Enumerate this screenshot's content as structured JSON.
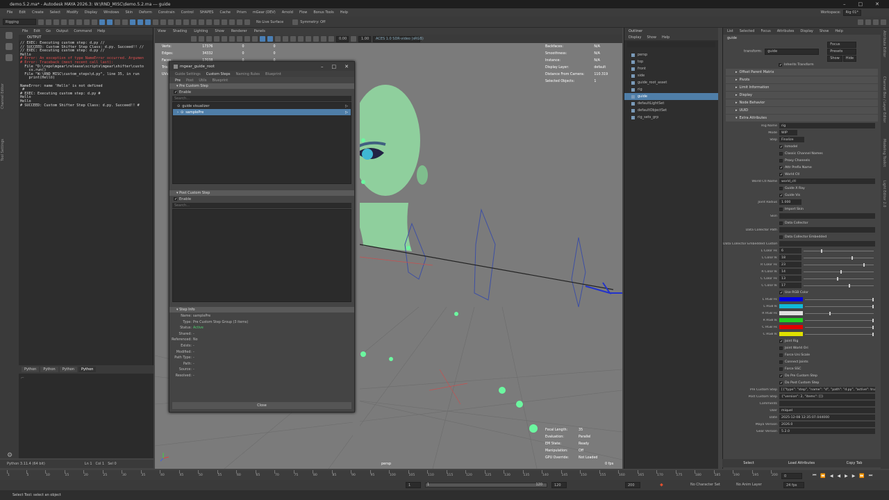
{
  "window": {
    "title": "demo.5.2.ma* - Autodesk MAYA 2026.3: W:\\RND_MISC\\demo.5.2.ma --- guide"
  },
  "menubar": [
    "File",
    "Edit",
    "Create",
    "Select",
    "Modify",
    "Display",
    "Windows",
    "Skin",
    "Deform",
    "Constrain",
    "Control",
    "SHAPES",
    "Cache",
    "Prism",
    "mGear (DEV)",
    "Arnold",
    "Flow",
    "Bonus Tools",
    "Help"
  ],
  "workspace": {
    "label": "Workspace:",
    "value": "Rig 01*"
  },
  "shelf": {
    "menuset": "Rigging",
    "symmetry": "Symmetry: Off",
    "live": "No Live Surface"
  },
  "left_tools_labels": [
    "Channel Editor",
    "Tool Settings"
  ],
  "script_editor": {
    "menus": [
      "File",
      "Edit",
      "Go",
      "Output",
      "Command",
      "Help"
    ],
    "output_label": "OUTPUT",
    "log": [
      {
        "t": "// EXEC: Executing custom step: d.py //",
        "e": false
      },
      {
        "t": "// SUCCEED: Custom Shifter Step Class: d.py. Succeed!! //",
        "e": false
      },
      {
        "t": "// EXEC: Executing custom step: d.py //",
        "e": false
      },
      {
        "t": "Hello",
        "e": false
      },
      {
        "t": "# Error: An exception of type NameError occurred. Argumen",
        "e": true
      },
      {
        "t": "# Error: Traceback (most recent call last):",
        "e": true
      },
      {
        "t": "  File \"D:\\repo\\mgear\\release\\scripts\\mgear\\shifter\\custo",
        "e": false
      },
      {
        "t": "    cs.run()",
        "e": false
      },
      {
        "t": "  File \"W:\\RND_MISC\\custom_steps\\d.py\", line 35, in run",
        "e": false
      },
      {
        "t": "    print(Hello)",
        "e": false
      },
      {
        "t": "",
        "e": false
      },
      {
        "t": "NameError: name 'Hello' is not defined",
        "e": false
      },
      {
        "t": " #",
        "e": false
      },
      {
        "t": "# EXEC: Executing custom step: d.py #",
        "e": false
      },
      {
        "t": "Hello",
        "e": false
      },
      {
        "t": "Hello",
        "e": false
      },
      {
        "t": "# SUCCEED: Custom Shifter Step Class: d.py. Succeed!! #",
        "e": false
      }
    ],
    "tabs": [
      "Python",
      "Python",
      "Python",
      "Python"
    ],
    "pyline": "Python 3.11.4 (64 bit)",
    "pyline_stats": [
      "Ln 1",
      "Col 1",
      "Sel 0"
    ]
  },
  "viewport": {
    "menus": [
      "View",
      "Shading",
      "Lighting",
      "Show",
      "Renderer",
      "Panels"
    ],
    "exposure": "0.00",
    "gamma": "1.00",
    "colorspace": "ACES 1.0 SDR-video (sRGB)",
    "hud_left": [
      [
        "Verts:",
        "17376",
        "0",
        "0"
      ],
      [
        "Edges:",
        "34332",
        "0",
        "0"
      ],
      [
        "Faces:",
        "17038",
        "0",
        "0"
      ],
      [
        "Tris:",
        "",
        "",
        ""
      ],
      [
        "UVs:",
        "",
        "",
        ""
      ]
    ],
    "hud_right": [
      [
        "Backfaces:",
        "N/A"
      ],
      [
        "Smoothness:",
        "N/A"
      ],
      [
        "Instance:",
        "N/A"
      ],
      [
        "Display Layer:",
        "default"
      ],
      [
        "Distance From Camera:",
        "110.319"
      ],
      [
        "Selected Objects:",
        "1"
      ]
    ],
    "hud_bottom": [
      [
        "Focal Length:",
        "35"
      ],
      [
        "Evaluation:",
        "Parallel"
      ],
      [
        "EM State:",
        "Ready"
      ],
      [
        "Manipulation:",
        "Off"
      ],
      [
        "GPU Override:",
        "Not Loaded"
      ]
    ],
    "camera": "persp",
    "fps": "0 fps"
  },
  "dialog": {
    "title": "mgear_guide_root",
    "tabs": [
      "Guide Settings",
      "Custom Steps",
      "Naming Rules",
      "Blueprint"
    ],
    "active_tab": 1,
    "subtabs": [
      "Pre",
      "Post",
      "Utils",
      "Blueprint"
    ],
    "pre_section": "Pre Custom Step",
    "enable_label": "Enable",
    "search_placeholder": "Search...",
    "pre_items": [
      {
        "label": "guide visualizer",
        "selected": false
      },
      {
        "label": "samplePre",
        "selected": true
      }
    ],
    "post_section": "Post Custom Step",
    "info_section": "Step Info",
    "info": [
      [
        "Name:",
        "samplePre"
      ],
      [
        "Type:",
        "Pre Custom Step Group (3 items)"
      ],
      [
        "Status:",
        "Active"
      ],
      [
        "Shared:",
        "-"
      ],
      [
        "Referenced:",
        "No"
      ],
      [
        "Exists:",
        "-"
      ],
      [
        "Modified:",
        "-"
      ],
      [
        "Path Type:",
        "-"
      ],
      [
        "Path:",
        "-"
      ],
      [
        "Source:",
        "-"
      ],
      [
        "Resolved:",
        "-"
      ]
    ],
    "close_label": "Close"
  },
  "outliner": {
    "title": "Outliner",
    "menus": [
      "Display",
      "Show",
      "Help"
    ],
    "search_placeholder": "",
    "items": [
      {
        "label": "persp",
        "selected": false
      },
      {
        "label": "top",
        "selected": false
      },
      {
        "label": "front",
        "selected": false
      },
      {
        "label": "side",
        "selected": false
      },
      {
        "label": "guide_root_asset",
        "selected": false
      },
      {
        "label": "rig",
        "selected": false
      },
      {
        "label": "guide",
        "selected": true
      },
      {
        "label": "defaultLightSet",
        "selected": false
      },
      {
        "label": "defaultObjectSet",
        "selected": false
      },
      {
        "label": "rig_sets_grp",
        "selected": false
      }
    ]
  },
  "attribute_editor": {
    "menus": [
      "List",
      "Selected",
      "Focus",
      "Attributes",
      "Display",
      "Show",
      "Help"
    ],
    "node_tab": "guide",
    "transform_label": "transform:",
    "transform_value": "guide",
    "buttons": [
      "Focus",
      "Presets",
      "Show",
      "Hide"
    ],
    "inherits_transform": "Inherits Transform",
    "offset_parent": "Offset Parent Matrix",
    "sections": [
      "Pivots",
      "Limit Information",
      "Display",
      "Node Behavior",
      "UUID",
      "Extra Attributes"
    ],
    "rig_name": {
      "label": "Rig Name",
      "value": "rig"
    },
    "mode": {
      "label": "Mode",
      "value": "WIP"
    },
    "step": {
      "label": "Step",
      "value": "Finalize"
    },
    "checks_a": [
      {
        "label": "Ismodel",
        "on": true
      },
      {
        "label": "Classic Channel Names",
        "on": false
      },
      {
        "label": "Proxy Channels",
        "on": false
      },
      {
        "label": "Attr Prefix Name",
        "on": true
      },
      {
        "label": "World Ctl",
        "on": true
      }
    ],
    "world_ctl_name": {
      "label": "World Ctl Name",
      "value": "world_ctl"
    },
    "checks_b": [
      {
        "label": "Guide X Ray",
        "on": false
      },
      {
        "label": "Guide Vis",
        "on": true
      }
    ],
    "joint_radius": {
      "label": "Joint Radius",
      "value": "1.000"
    },
    "import_skin": {
      "label": "Import Skin",
      "on": false
    },
    "skin": {
      "label": "Skin",
      "value": ""
    },
    "data_collector": {
      "label": "Data Collector",
      "on": false
    },
    "data_collector_path": {
      "label": "Data Collector Path",
      "value": ""
    },
    "data_collector_embedded": {
      "label": "Data Collector Embedded",
      "on": false
    },
    "dce_custom_joint": {
      "label": "Data Collector Embedded Custom Joint",
      "value": ""
    },
    "color_fk": [
      {
        "label": "L Color Fk",
        "value": "6",
        "pos": 0.25
      },
      {
        "label": "L Color Ik",
        "value": "18",
        "pos": 0.68
      },
      {
        "label": "R Color Fk",
        "value": "23",
        "pos": 0.85
      },
      {
        "label": "R Color Ik",
        "value": "14",
        "pos": 0.52
      },
      {
        "label": "C Color Fk",
        "value": "13",
        "pos": 0.48
      },
      {
        "label": "C Color Ik",
        "value": "17",
        "pos": 0.64
      }
    ],
    "use_rgb": {
      "label": "Use RGB Color",
      "on": true
    },
    "rgb": [
      {
        "label": "L RGB Fk",
        "color": "#0000e0",
        "pos": 0.98
      },
      {
        "label": "L RGB Ik",
        "color": "#10b8d8",
        "pos": 0.98
      },
      {
        "label": "R RGB Fk",
        "color": "#e0e0e0",
        "pos": 0.35
      },
      {
        "label": "R RGB Ik",
        "color": "#20d020",
        "pos": 0.98
      },
      {
        "label": "C RGB Fk",
        "color": "#e00000",
        "pos": 0.98
      },
      {
        "label": "C RGB Ik",
        "color": "#e0e000",
        "pos": 0.98
      }
    ],
    "checks_c": [
      {
        "label": "Joint Rig",
        "on": true
      },
      {
        "label": "Joint World Ori",
        "on": false
      },
      {
        "label": "Force Uni Scale",
        "on": false
      },
      {
        "label": "Connect Joints",
        "on": false
      },
      {
        "label": "Force SSC",
        "on": false
      },
      {
        "label": "Do Pre Custom Step",
        "on": true
      },
      {
        "label": "Do Post Custom Step",
        "on": true
      }
    ],
    "fields_end": [
      {
        "label": "Pre Custom Step",
        "value": "[{\"type\": \"step\", \"name\": \"d\", \"path\": \"d.py\", \"active\": true}]"
      },
      {
        "label": "Post Custom Step",
        "value": "{\"version\": 2, \"items\": []}"
      },
      {
        "label": "Comments",
        "value": ""
      },
      {
        "label": "User",
        "value": "miquel"
      },
      {
        "label": "Date",
        "value": "2025-12-08 12:35:07.044000"
      },
      {
        "label": "Maya Version",
        "value": "2026.0"
      },
      {
        "label": "Gear Version",
        "value": "5.2.0"
      }
    ],
    "footer": [
      "Select",
      "Load Attributes",
      "Copy Tab"
    ]
  },
  "right_strip_labels": [
    "Attribute Editor",
    "Channel Box / Layer Editor",
    "Modeling Toolkit",
    "Light Editor 2.0"
  ],
  "timeline": {
    "ticks": [
      "1",
      "5",
      "10",
      "15",
      "20",
      "25",
      "30",
      "35",
      "40",
      "45",
      "50",
      "55",
      "60",
      "65",
      "70",
      "75",
      "80",
      "85",
      "90",
      "95",
      "100",
      "105",
      "110",
      "115",
      "120",
      "125",
      "130",
      "135",
      "140",
      "145",
      "150",
      "155",
      "160",
      "165",
      "170",
      "175",
      "180",
      "185",
      "190",
      "195",
      "200"
    ],
    "current": "0"
  },
  "range": {
    "start": "1",
    "start2": "1",
    "end": "120",
    "end2": "200",
    "character_set": "No Character Set",
    "anim_layer": "No Anim Layer",
    "fps": "24 fps"
  },
  "status": "Select Tool: select an object"
}
